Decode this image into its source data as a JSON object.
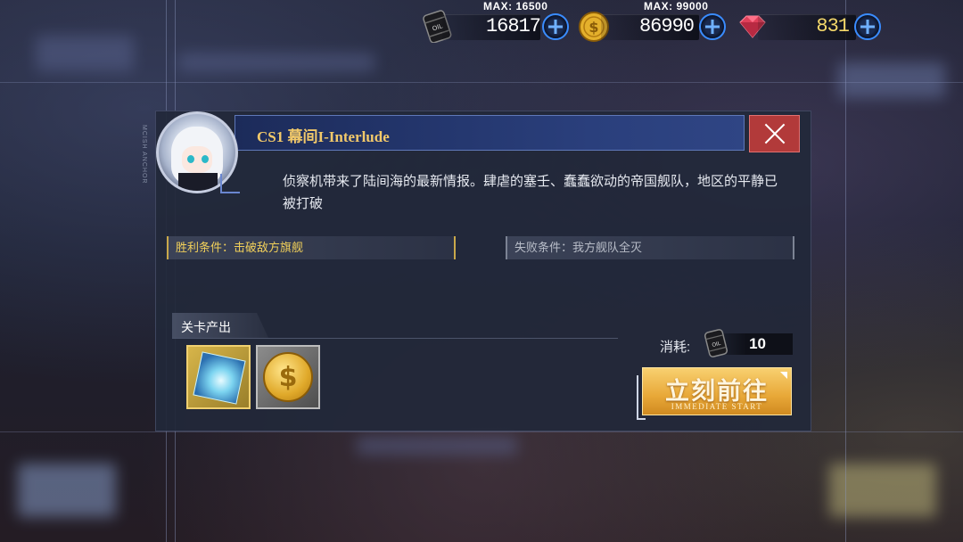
{
  "resources": {
    "oil": {
      "max_label": "MAX: 16500",
      "value": "16817",
      "icon": "oil-barrel-icon"
    },
    "gold": {
      "max_label": "MAX: 99000",
      "value": "86990",
      "icon": "gold-coin-icon"
    },
    "gem": {
      "value": "831",
      "icon": "gem-icon"
    }
  },
  "stage": {
    "title": "CS1 幕间I-Interlude",
    "description": "侦察机带来了陆间海的最新情报。肆虐的塞壬、蠢蠢欲动的帝国舰队，地区的平静已被打破",
    "win_condition": "胜利条件：击破敌方旗舰",
    "lose_condition": "失败条件：我方舰队全灭",
    "drops_label": "关卡产出",
    "drops": [
      {
        "name": "cube",
        "icon": "blue-cube-icon"
      },
      {
        "name": "coin",
        "icon": "gold-coin-icon"
      }
    ],
    "cost_label": "消耗:",
    "cost_value": "10",
    "go_button_label": "立刻前往",
    "go_button_sub": "IMMEDIATE START"
  },
  "colors": {
    "accent_blue": "#3a8cff",
    "title_gold": "#f2c96a",
    "win_yellow": "#f0cf5a",
    "close_red": "#b23a3a",
    "button_orange": "#e8a838"
  }
}
